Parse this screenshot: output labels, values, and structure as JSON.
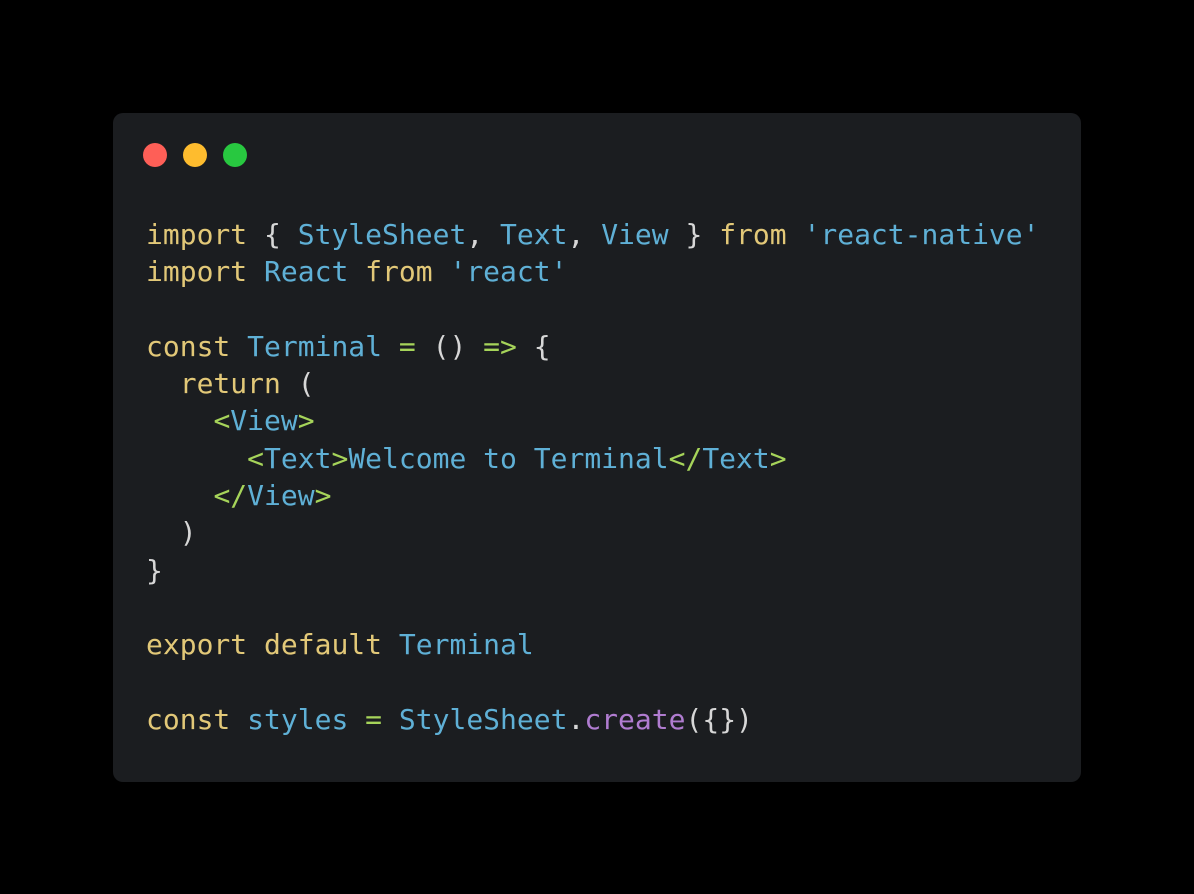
{
  "window": {
    "controls": [
      {
        "name": "close",
        "color": "#fe5f57"
      },
      {
        "name": "minimize",
        "color": "#febc2e"
      },
      {
        "name": "maximize",
        "color": "#28c840"
      }
    ]
  },
  "code": {
    "lines": [
      [
        {
          "t": "import",
          "c": "kw"
        },
        {
          "t": " { ",
          "c": "punc"
        },
        {
          "t": "StyleSheet",
          "c": "id"
        },
        {
          "t": ", ",
          "c": "punc"
        },
        {
          "t": "Text",
          "c": "id"
        },
        {
          "t": ", ",
          "c": "punc"
        },
        {
          "t": "View",
          "c": "id"
        },
        {
          "t": " } ",
          "c": "punc"
        },
        {
          "t": "from",
          "c": "kw"
        },
        {
          "t": " ",
          "c": "punc"
        },
        {
          "t": "'react-native'",
          "c": "str"
        }
      ],
      [
        {
          "t": "import",
          "c": "kw"
        },
        {
          "t": " ",
          "c": "punc"
        },
        {
          "t": "React",
          "c": "id"
        },
        {
          "t": " ",
          "c": "punc"
        },
        {
          "t": "from",
          "c": "kw"
        },
        {
          "t": " ",
          "c": "punc"
        },
        {
          "t": "'react'",
          "c": "str"
        }
      ],
      [],
      [
        {
          "t": "const",
          "c": "kw"
        },
        {
          "t": " ",
          "c": "punc"
        },
        {
          "t": "Terminal",
          "c": "id"
        },
        {
          "t": " ",
          "c": "punc"
        },
        {
          "t": "=",
          "c": "op"
        },
        {
          "t": " () ",
          "c": "punc"
        },
        {
          "t": "=>",
          "c": "op"
        },
        {
          "t": " {",
          "c": "punc"
        }
      ],
      [
        {
          "t": "  ",
          "c": "punc"
        },
        {
          "t": "return",
          "c": "kw"
        },
        {
          "t": " (",
          "c": "punc"
        }
      ],
      [
        {
          "t": "    ",
          "c": "punc"
        },
        {
          "t": "<",
          "c": "tag"
        },
        {
          "t": "View",
          "c": "id"
        },
        {
          "t": ">",
          "c": "tag"
        }
      ],
      [
        {
          "t": "      ",
          "c": "punc"
        },
        {
          "t": "<",
          "c": "tag"
        },
        {
          "t": "Text",
          "c": "id"
        },
        {
          "t": ">",
          "c": "tag"
        },
        {
          "t": "Welcome to Terminal",
          "c": "txt"
        },
        {
          "t": "</",
          "c": "tag"
        },
        {
          "t": "Text",
          "c": "id"
        },
        {
          "t": ">",
          "c": "tag"
        }
      ],
      [
        {
          "t": "    ",
          "c": "punc"
        },
        {
          "t": "</",
          "c": "tag"
        },
        {
          "t": "View",
          "c": "id"
        },
        {
          "t": ">",
          "c": "tag"
        }
      ],
      [
        {
          "t": "  )",
          "c": "punc"
        }
      ],
      [
        {
          "t": "}",
          "c": "punc"
        }
      ],
      [],
      [
        {
          "t": "export",
          "c": "kw"
        },
        {
          "t": " ",
          "c": "punc"
        },
        {
          "t": "default",
          "c": "kw"
        },
        {
          "t": " ",
          "c": "punc"
        },
        {
          "t": "Terminal",
          "c": "id"
        }
      ],
      [],
      [
        {
          "t": "const",
          "c": "kw"
        },
        {
          "t": " ",
          "c": "punc"
        },
        {
          "t": "styles",
          "c": "id"
        },
        {
          "t": " ",
          "c": "punc"
        },
        {
          "t": "=",
          "c": "op"
        },
        {
          "t": " ",
          "c": "punc"
        },
        {
          "t": "StyleSheet",
          "c": "id"
        },
        {
          "t": ".",
          "c": "punc"
        },
        {
          "t": "create",
          "c": "fn"
        },
        {
          "t": "({})",
          "c": "punc"
        }
      ]
    ]
  }
}
